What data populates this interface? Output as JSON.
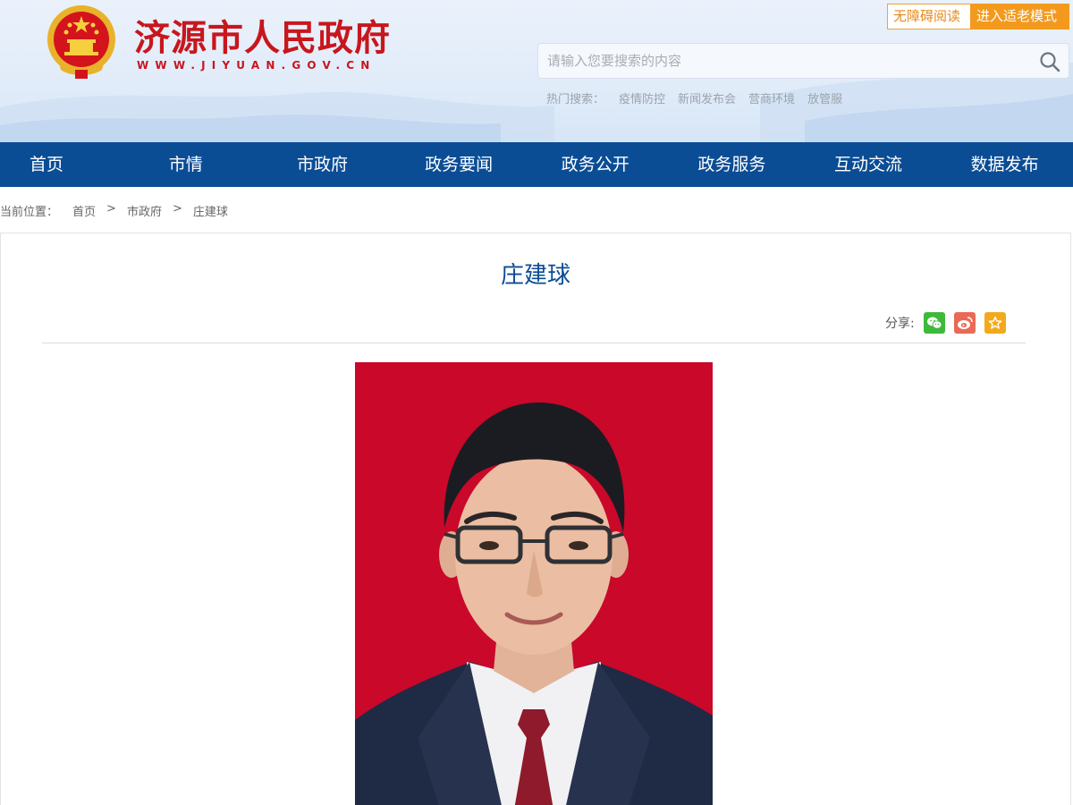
{
  "header": {
    "site_title": "济源市人民政府",
    "site_url": "WWW.JIYUAN.GOV.CN",
    "accessibility_button": "无障碍阅读",
    "elder_mode_button": "进入适老模式",
    "search": {
      "placeholder": "请输入您要搜索的内容"
    },
    "hot_search": {
      "label": "热门搜索：",
      "items": [
        "疫情防控",
        "新闻发布会",
        "营商环境",
        "放管服"
      ]
    }
  },
  "nav": {
    "items": [
      "首页",
      "市情",
      "市政府",
      "政务要闻",
      "政务公开",
      "政务服务",
      "互动交流",
      "数据发布"
    ]
  },
  "breadcrumb": {
    "label": "当前位置：",
    "items": [
      "首页",
      "市政府",
      "庄建球"
    ],
    "separator": ">"
  },
  "article": {
    "title": "庄建球",
    "share_label": "分享:",
    "share_icons": [
      "wechat-icon",
      "weibo-icon",
      "favorite-icon"
    ]
  },
  "colors": {
    "brand_red": "#c8161d",
    "nav_blue": "#0b4d95",
    "accent_orange": "#f39a1e",
    "portrait_bg": "#c9082a"
  }
}
